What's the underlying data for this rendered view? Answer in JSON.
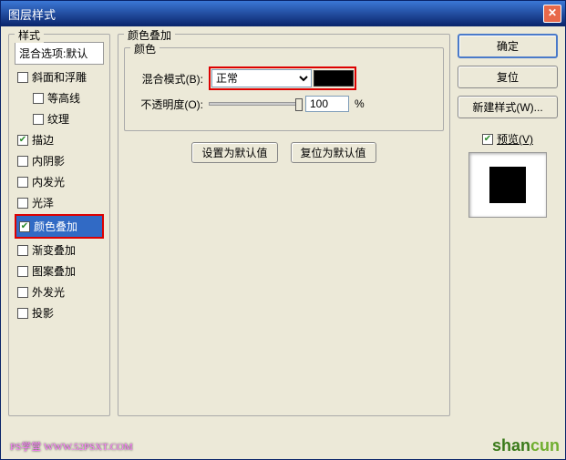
{
  "window": {
    "title": "图层样式"
  },
  "left": {
    "group": "样式",
    "header": "混合选项:默认",
    "items": [
      {
        "label": "斜面和浮雕",
        "checked": false
      },
      {
        "label": "等高线",
        "checked": false,
        "indent": true
      },
      {
        "label": "纹理",
        "checked": false,
        "indent": true
      },
      {
        "label": "描边",
        "checked": true
      },
      {
        "label": "内阴影",
        "checked": false
      },
      {
        "label": "内发光",
        "checked": false
      },
      {
        "label": "光泽",
        "checked": false
      },
      {
        "label": "颜色叠加",
        "checked": true,
        "selected": true,
        "highlight": true
      },
      {
        "label": "渐变叠加",
        "checked": false
      },
      {
        "label": "图案叠加",
        "checked": false
      },
      {
        "label": "外发光",
        "checked": false
      },
      {
        "label": "投影",
        "checked": false
      }
    ]
  },
  "mid": {
    "group": "颜色叠加",
    "inner": "颜色",
    "blend_label": "混合模式(B):",
    "blend_value": "正常",
    "opacity_label": "不透明度(O):",
    "opacity_value": "100",
    "opacity_unit": "%",
    "default_btn": "设置为默认值",
    "reset_btn": "复位为默认值",
    "swatch_color": "#000000"
  },
  "right": {
    "ok": "确定",
    "cancel": "复位",
    "newstyle": "新建样式(W)...",
    "preview_label": "预览(V)"
  },
  "watermarks": {
    "left": "PS学堂  WWW.52PSXT.COM",
    "right": "shancun"
  }
}
